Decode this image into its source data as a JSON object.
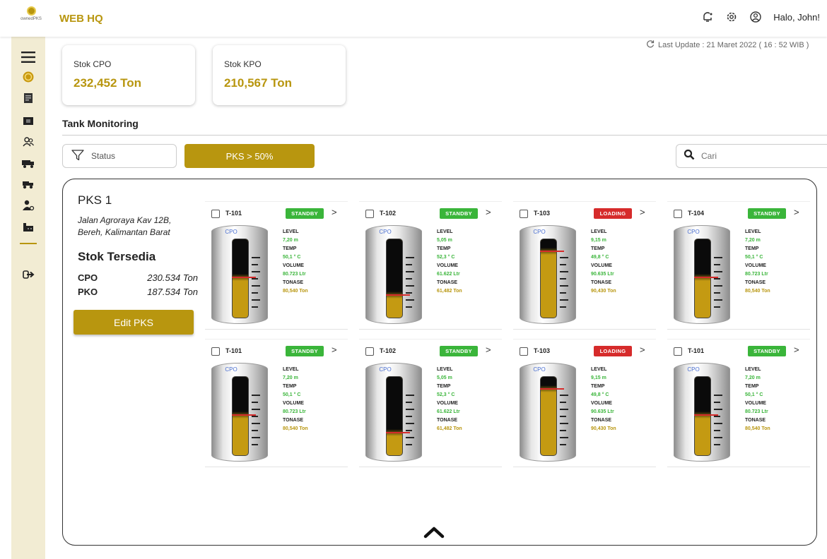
{
  "app": {
    "logo_text": "ownedPKS",
    "title": "WEB HQ",
    "greeting": "Halo, John!"
  },
  "sidebar": {
    "items": [
      {
        "icon": "menu-icon"
      },
      {
        "icon": "coin-icon"
      },
      {
        "icon": "report-icon"
      },
      {
        "icon": "document-icon"
      },
      {
        "icon": "users-icon"
      },
      {
        "icon": "truck-icon"
      },
      {
        "icon": "vehicle-icon"
      },
      {
        "icon": "user-settings-icon"
      },
      {
        "icon": "factory-icon"
      },
      {
        "icon": "logout-icon"
      }
    ]
  },
  "stocks": [
    {
      "label": "Stok CPO",
      "value": "232,452 Ton"
    },
    {
      "label": "Stok KPO",
      "value": "210,567 Ton"
    }
  ],
  "last_update": "Last Update : 21 Maret 2022 ( 16 : 52 WIB )",
  "section_title": "Tank Monitoring",
  "filter": {
    "label": "Status"
  },
  "pks_filter": "PKS > 50%",
  "search": {
    "placeholder": "Cari"
  },
  "pks": {
    "name": "PKS 1",
    "address_line1": "Jalan Agroraya Kav 12B,",
    "address_line2": "Bereh, Kalimantan Barat",
    "stok_title": "Stok Tersedia",
    "stok": [
      {
        "label": "CPO",
        "value": "230.534 Ton"
      },
      {
        "label": "PKO",
        "value": "187.534 Ton"
      }
    ],
    "edit_label": "Edit PKS"
  },
  "labels": {
    "level": "LEVEL",
    "temp": "TEMP",
    "volume": "VOLUME",
    "tonase": "TONASE"
  },
  "colors": {
    "accent": "#b8960f",
    "standby": "#3ab53a",
    "loading": "#d62b2b",
    "level_value": "#3ab53a",
    "tonase_value": "#b8960f"
  },
  "tanks": [
    {
      "id": "T-101",
      "status": "STANDBY",
      "product": "CPO",
      "level": "7,20 m",
      "temp": "50,1 ° C",
      "volume": "80.723 Ltr",
      "tonase": "80,540 Ton",
      "fill_pct": 52
    },
    {
      "id": "T-102",
      "status": "STANDBY",
      "product": "CPO",
      "level": "5,05 m",
      "temp": "52,3 ° C",
      "volume": "61.622 Ltr",
      "tonase": "61,482 Ton",
      "fill_pct": 30
    },
    {
      "id": "T-103",
      "status": "LOADING",
      "product": "CPO",
      "level": "9,15 m",
      "temp": "49,8 ° C",
      "volume": "90.635 Ltr",
      "tonase": "90,430 Ton",
      "fill_pct": 85
    },
    {
      "id": "T-104",
      "status": "STANDBY",
      "product": "CPO",
      "level": "7,20 m",
      "temp": "50,1 ° C",
      "volume": "80.723 Ltr",
      "tonase": "80,540 Ton",
      "fill_pct": 52
    },
    {
      "id": "T-101",
      "status": "STANDBY",
      "product": "CPO",
      "level": "7,20 m",
      "temp": "50,1 ° C",
      "volume": "80.723 Ltr",
      "tonase": "80,540 Ton",
      "fill_pct": 52
    },
    {
      "id": "T-102",
      "status": "STANDBY",
      "product": "CPO",
      "level": "5,05 m",
      "temp": "52,3 ° C",
      "volume": "61.622 Ltr",
      "tonase": "61,482 Ton",
      "fill_pct": 30
    },
    {
      "id": "T-103",
      "status": "LOADING",
      "product": "CPO",
      "level": "9,15 m",
      "temp": "49,8 ° C",
      "volume": "90.635 Ltr",
      "tonase": "90,430 Ton",
      "fill_pct": 85
    },
    {
      "id": "T-101",
      "status": "STANDBY",
      "product": "CPO",
      "level": "7,20 m",
      "temp": "50,1 ° C",
      "volume": "80.723 Ltr",
      "tonase": "80,540 Ton",
      "fill_pct": 52
    }
  ]
}
